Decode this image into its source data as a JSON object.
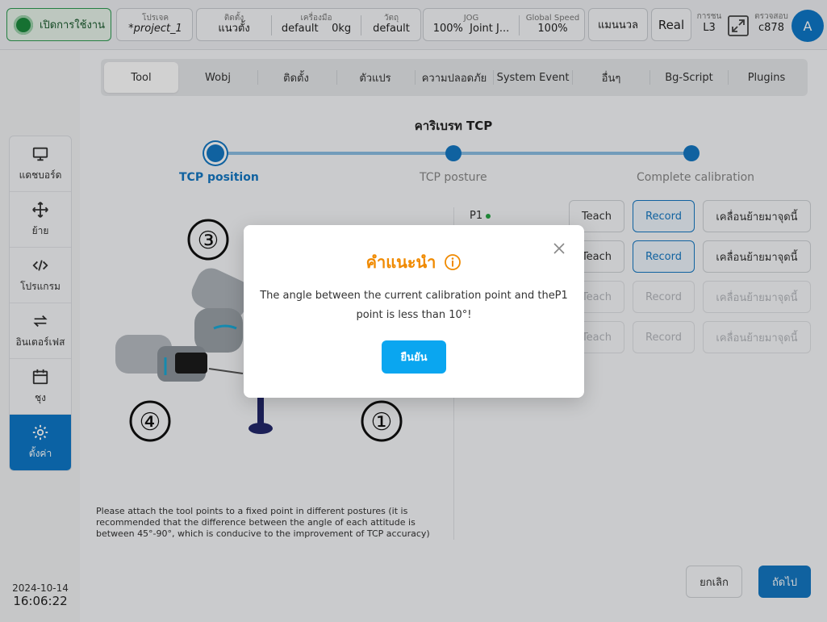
{
  "topbar": {
    "power_label": "เปิดการใช้งาน",
    "project": {
      "label": "โปรเจค",
      "value": "*project_1"
    },
    "install": {
      "label": "ติดตั้ง",
      "value": "แนวตั้ง"
    },
    "tool": {
      "label": "เครื่องมือ",
      "value": "default",
      "weight": "0kg"
    },
    "object": {
      "label": "วัตถุ",
      "value": "default"
    },
    "jog": {
      "label": "JOG",
      "value": "100%",
      "mode": "Joint J..."
    },
    "global_speed": {
      "label": "Global Speed",
      "value": "100%"
    },
    "manual_label": "แมนนวล",
    "real_label": "Real",
    "collision": {
      "label": "การชน",
      "value": "L3"
    },
    "check": {
      "label": "ตรวจสอบ",
      "value": "c878"
    },
    "avatar_letter": "A"
  },
  "sidebar": {
    "items": [
      {
        "label": "แดชบอร์ด",
        "icon": "monitor-icon"
      },
      {
        "label": "ย้าย",
        "icon": "move-icon"
      },
      {
        "label": "โปรแกรม",
        "icon": "code-icon"
      },
      {
        "label": "อินเตอร์เฟส",
        "icon": "interface-icon"
      },
      {
        "label": "ชุง",
        "icon": "calendar-icon"
      },
      {
        "label": "ตั้งค่า",
        "icon": "gear-icon",
        "active": true
      }
    ]
  },
  "datetime": {
    "date": "2024-10-14",
    "time": "16:06:22"
  },
  "tabs": [
    "Tool",
    "Wobj",
    "ติดตั้ง",
    "ตัวแปร",
    "ความปลอดภัย",
    "System Event",
    "อื่นๆ",
    "Bg-Script",
    "Plugins"
  ],
  "calibration": {
    "title": "คาริเบรท TCP",
    "steps": [
      "TCP position",
      "TCP posture",
      "Complete calibration"
    ],
    "hint": "Please attach the tool points to a fixed point in different postures (it is recommended that the difference between the angle of each attitude is between 45°-90°, which is conducive to the improvement of TCP accuracy)",
    "markers": [
      "③",
      "④",
      "①"
    ],
    "points": [
      {
        "label": "P1",
        "teach": "Teach",
        "record": "Record",
        "move": "เคลื่อนย้ายมาจุดนี้"
      },
      {
        "label": "",
        "teach": "Teach",
        "record": "Record",
        "move": "เคลื่อนย้ายมาจุดนี้"
      },
      {
        "label": "",
        "teach": "Teach",
        "record": "Record",
        "move": "เคลื่อนย้ายมาจุดนี้"
      },
      {
        "label": "",
        "teach": "Teach",
        "record": "Record",
        "move": "เคลื่อนย้ายมาจุดนี้"
      }
    ],
    "cancel_label": "ยกเลิก",
    "next_label": "ถัดไป"
  },
  "modal": {
    "title": "คำแนะนำ",
    "message_line1": "The angle between the current calibration point and theP1",
    "message_line2": "point is less than 10°!",
    "confirm_label": "ยืนยัน"
  },
  "colors": {
    "accent": "#1478c4",
    "warning": "#f08a00",
    "confirm": "#0aa6f0",
    "success": "#28a745"
  }
}
